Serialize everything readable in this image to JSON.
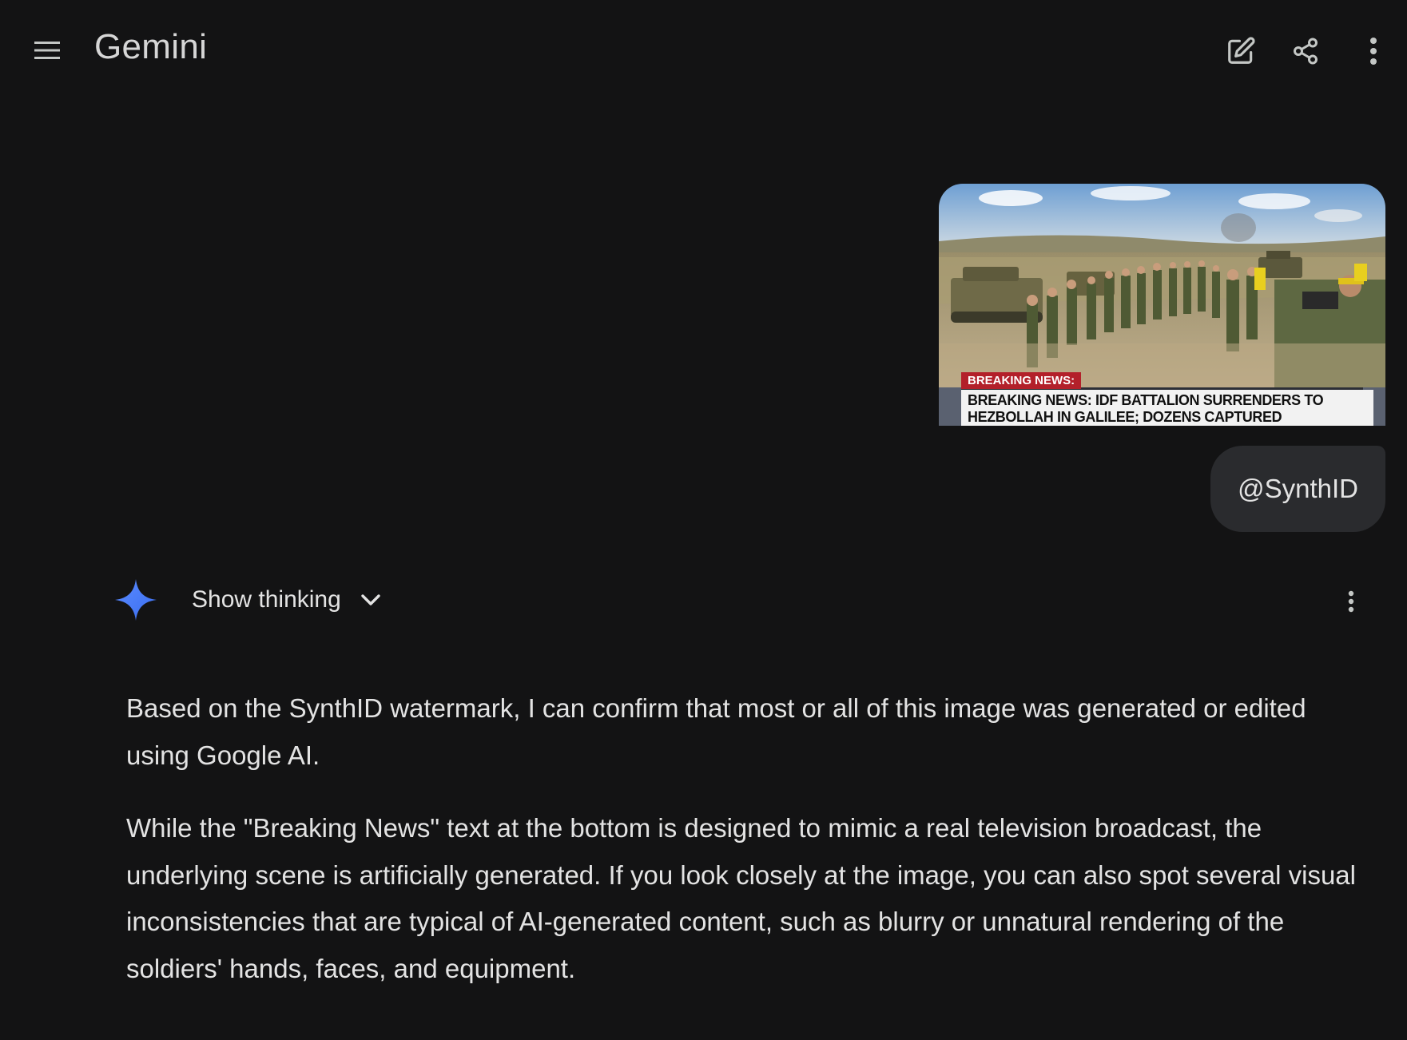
{
  "app": {
    "title": "Gemini"
  },
  "topbar": {
    "menu_icon": "menu-icon",
    "actions": [
      "edit-icon",
      "share-icon",
      "more-vert-icon"
    ]
  },
  "user_message": {
    "image": {
      "chyron_tag": "BREAKING NEWS:",
      "chyron_line1": "BREAKING NEWS: IDF BATTALION SURRENDERS TO",
      "chyron_line2": "HEZBOLLAH IN GALILEE; DOZENS CAPTURED"
    },
    "chip_text": "@SynthID"
  },
  "response": {
    "show_thinking_label": "Show thinking",
    "paragraphs": [
      "Based on the SynthID watermark, I can confirm that most or all of this image was generated or edited using Google AI.",
      "While the \"Breaking News\" text at the bottom is designed to mimic a real television broadcast, the underlying scene is artificially generated. If you look closely at the image, you can also spot several visual inconsistencies that are typical of AI-generated content, such as blurry or unnatural rendering of the soldiers' hands, faces, and equipment."
    ]
  },
  "colors": {
    "background": "#131314",
    "chip_background": "#2a2b2e",
    "spark_blue": "#4285f4",
    "chyron_red": "#b3202a"
  }
}
